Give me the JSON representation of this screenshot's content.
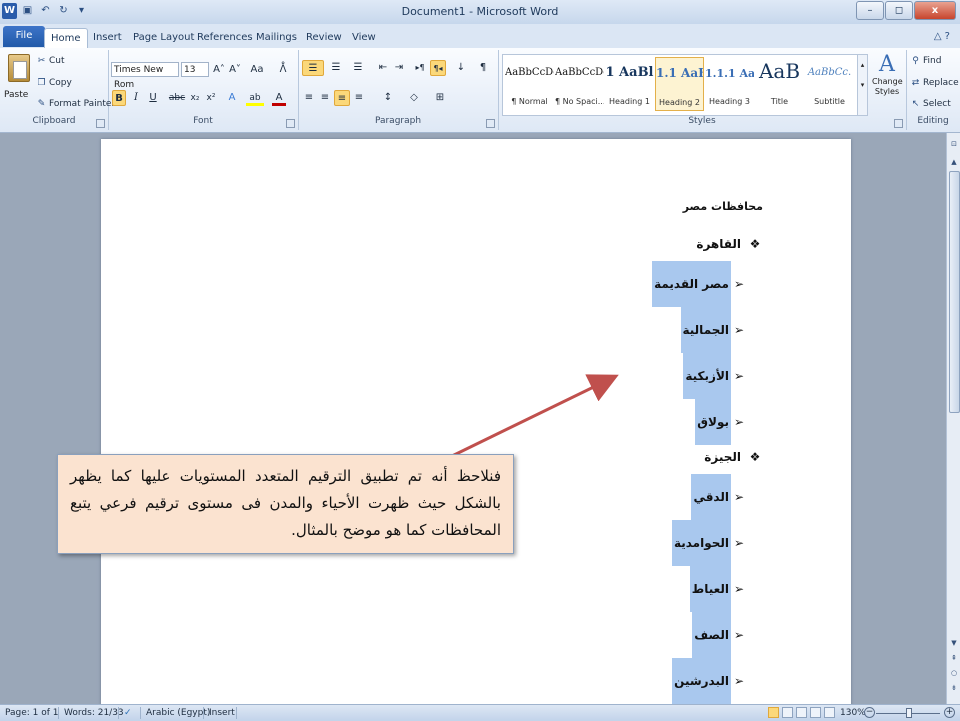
{
  "window": {
    "title": "Document1 - Microsoft Word",
    "minimize": "–",
    "maximize": "◻",
    "close": "x"
  },
  "quick_access": {
    "word_logo": "W",
    "save": "▣",
    "undo": "↶",
    "redo": "↻",
    "customize": "▾"
  },
  "tabs": {
    "file": "File",
    "items": [
      "Home",
      "Insert",
      "Page Layout",
      "References",
      "Mailings",
      "Review",
      "View"
    ],
    "active": "Home",
    "right_icons": "△ ?"
  },
  "ribbon": {
    "clipboard": {
      "label": "Clipboard",
      "paste": "Paste",
      "cut": "Cut",
      "copy": "Copy",
      "format_painter": "Format Painter"
    },
    "font": {
      "label": "Font",
      "font_name": "Times New Rom",
      "font_size": "13",
      "grow": "A˄",
      "shrink": "A˅",
      "change_case": "Aa",
      "clear": "ᐰ",
      "bold": "B",
      "italic": "I",
      "underline": "U",
      "strike": "abc",
      "subscript": "x₂",
      "superscript": "x²",
      "text_effects": "A",
      "highlight": "ab",
      "font_color": "A"
    },
    "paragraph": {
      "label": "Paragraph",
      "bullets": "☰",
      "numbering": "☰",
      "multilevel": "☰",
      "decrease_indent": "⇤",
      "increase_indent": "⇥",
      "ltr": "▸¶",
      "rtl": "¶◂",
      "sort": "↓",
      "show_marks": "¶",
      "align_left": "≡",
      "center": "≡",
      "align_right": "≡",
      "justify": "≡",
      "line_spacing": "↕",
      "shading": "◇",
      "borders": "⊞"
    },
    "styles": {
      "label": "Styles",
      "items": [
        {
          "sample": "AaBbCcDc",
          "name": "¶ Normal"
        },
        {
          "sample": "AaBbCcDc",
          "name": "¶ No Spaci..."
        },
        {
          "sample": "1 AaBl",
          "name": "Heading 1"
        },
        {
          "sample": "1.1 AaE",
          "name": "Heading 2"
        },
        {
          "sample": "1.1.1 Aa",
          "name": "Heading 3"
        },
        {
          "sample": "AaB",
          "name": "Title"
        },
        {
          "sample": "AaBbCc.",
          "name": "Subtitle"
        }
      ],
      "selected": "Heading 2",
      "change_styles": "Change Styles",
      "change_styles_icon": "A"
    },
    "editing": {
      "label": "Editing",
      "find": "Find",
      "replace": "Replace",
      "select": "Select"
    }
  },
  "document": {
    "heading": "محافظات مصر",
    "level1_bullet": "❖",
    "level2_bullet": "➢",
    "groups": [
      {
        "name": "القاهرة",
        "items": [
          "مصر القديمة",
          "الجمالية",
          "الأزبكية",
          "بولاق"
        ]
      },
      {
        "name": "الجيزة",
        "items": [
          "الدقي",
          "الحوامدية",
          "العياط",
          "الصف",
          "البدرشين"
        ]
      }
    ],
    "callout": "فنلاحظ أنه تم تطبيق الترقيم المتعدد المستويات عليها كما يظهر بالشكل حيث ظهرت الأحياء والمدن  فى مستوى ترقيم فرعي يتبع المحافظات  كما هو موضح بالمثال."
  },
  "status": {
    "page": "Page: 1 of 1",
    "words": "Words: 21/33",
    "language": "Arabic (Egypt)",
    "mode": "Insert",
    "zoom": "130%",
    "zoom_fraction": 0.5
  },
  "colors": {
    "highlight": "#a9c8ee",
    "callout_fill": "#fbe3d0",
    "arrow": "#c0504d"
  }
}
